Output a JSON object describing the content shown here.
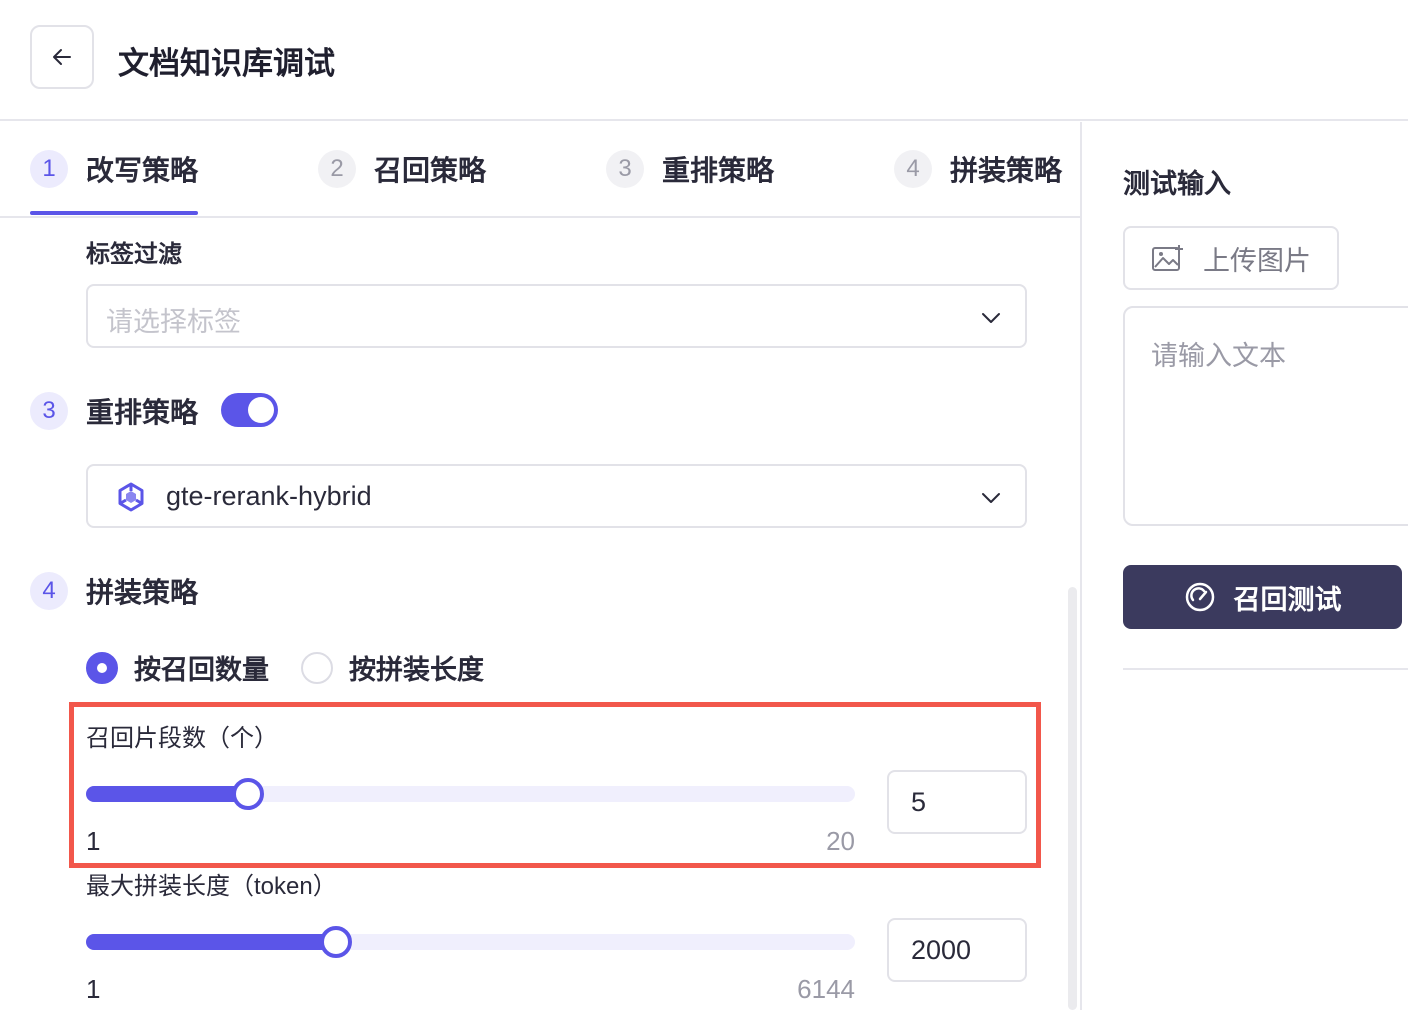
{
  "header": {
    "title": "文档知识库调试",
    "back_icon": "arrow-left-icon"
  },
  "tabs": [
    {
      "num": "1",
      "label": "改写策略",
      "active": true
    },
    {
      "num": "2",
      "label": "召回策略",
      "active": false
    },
    {
      "num": "3",
      "label": "重排策略",
      "active": false
    },
    {
      "num": "4",
      "label": "拼装策略",
      "active": false
    }
  ],
  "tag_filter": {
    "label": "标签过滤",
    "placeholder": "请选择标签"
  },
  "rerank": {
    "num": "3",
    "title": "重排策略",
    "enabled": true,
    "model": "gte-rerank-hybrid",
    "model_icon": "qwen-logo-icon"
  },
  "assembly": {
    "num": "4",
    "title": "拼装策略",
    "options": [
      {
        "label": "按召回数量",
        "checked": true
      },
      {
        "label": "按拼装长度",
        "checked": false
      }
    ],
    "recall_count": {
      "label": "召回片段数（个）",
      "min": "1",
      "max": "20",
      "value": "5",
      "min_num": 1,
      "max_num": 20,
      "value_num": 5
    },
    "max_length": {
      "label": "最大拼装长度（token）",
      "min": "1",
      "max": "6144",
      "value": "2000",
      "min_num": 1,
      "max_num": 6144,
      "value_num": 2000
    }
  },
  "test_panel": {
    "title": "测试输入",
    "upload_label": "上传图片",
    "text_placeholder": "请输入文本",
    "recall_test_label": "召回测试"
  },
  "colors": {
    "accent": "#5b55e8",
    "dark_button": "#3b3a5e",
    "highlight": "#f2574b"
  }
}
